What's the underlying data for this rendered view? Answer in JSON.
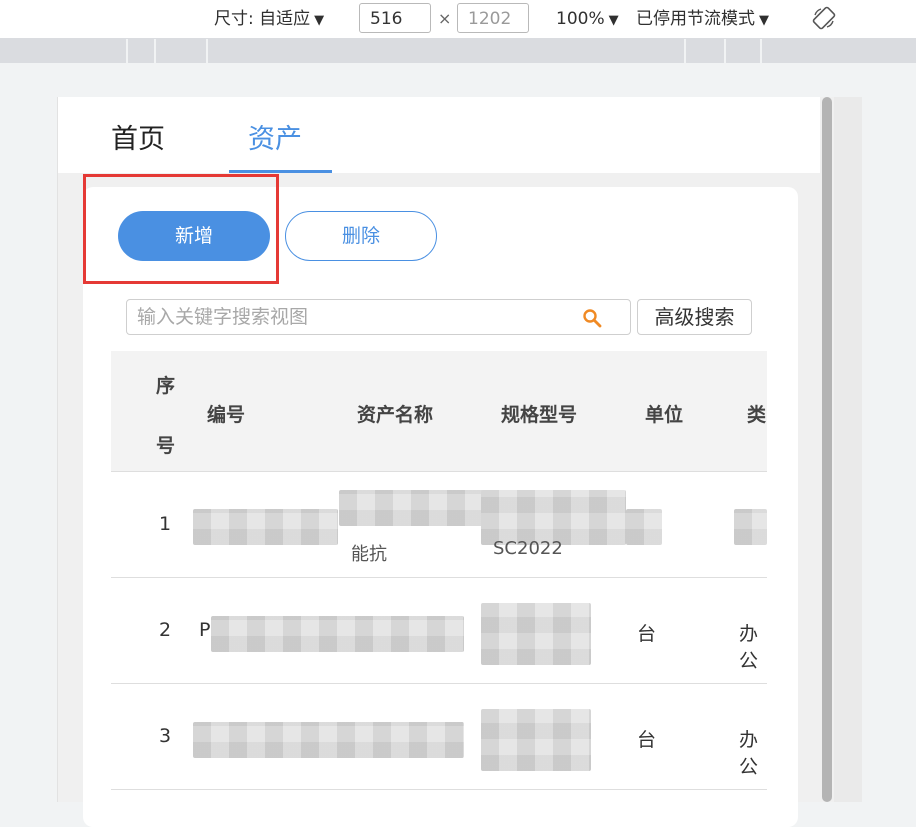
{
  "devtools": {
    "size_label": "尺寸: 自适应",
    "width": "516",
    "height_placeholder": "1202",
    "times": "×",
    "zoom": "100%",
    "throttle": "已停用节流模式",
    "arrow": "▼",
    "rotate_icon": "rotate-icon"
  },
  "tabs": [
    {
      "label": "首页"
    },
    {
      "label": "资产"
    }
  ],
  "toolbar": {
    "add_label": "新增",
    "delete_label": "删除",
    "search_placeholder": "输入关键字搜索视图",
    "advanced_search_label": "高级搜索"
  },
  "table": {
    "headers": {
      "seq_1": "序",
      "seq_2": "号",
      "code": "编号",
      "name": "资产名称",
      "model": "规格型号",
      "unit": "单位",
      "type": "类"
    },
    "rows": [
      {
        "seq": "1",
        "name_fragment": "能抗",
        "model_fragment": "SC2022",
        "unit": "",
        "type": ""
      },
      {
        "seq": "2",
        "code_fragment": "P",
        "unit": "台",
        "type": "办公"
      },
      {
        "seq": "3",
        "unit": "台",
        "type": "办公"
      }
    ]
  },
  "colors": {
    "accent": "#4a90e2",
    "highlight_box": "#e53935"
  }
}
